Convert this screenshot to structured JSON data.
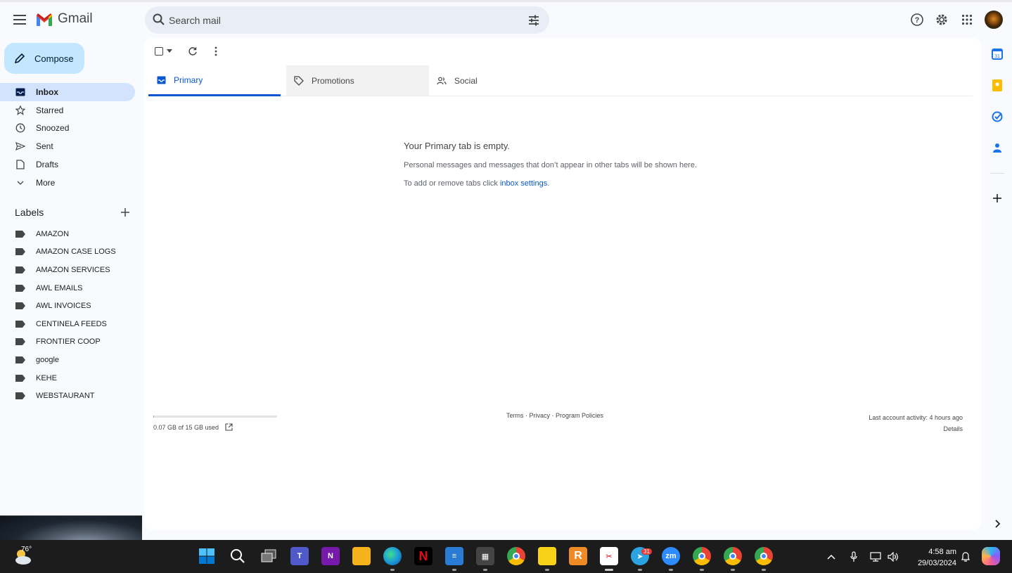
{
  "header": {
    "app_name": "Gmail",
    "search_placeholder": "Search mail"
  },
  "nav": {
    "compose_label": "Compose",
    "items": [
      {
        "label": "Inbox",
        "icon": "inbox-icon",
        "active": true
      },
      {
        "label": "Starred",
        "icon": "star-icon"
      },
      {
        "label": "Snoozed",
        "icon": "clock-icon"
      },
      {
        "label": "Sent",
        "icon": "send-icon"
      },
      {
        "label": "Drafts",
        "icon": "draft-icon"
      },
      {
        "label": "More",
        "icon": "chevron-down-icon"
      }
    ],
    "labels_heading": "Labels",
    "labels": [
      "AMAZON",
      "AMAZON CASE LOGS",
      "AMAZON SERVICES",
      "AWL EMAILS",
      "AWL INVOICES",
      "CENTINELA FEEDS",
      "FRONTIER COOP",
      "google",
      "KEHE",
      "WEBSTAURANT"
    ]
  },
  "tabs": {
    "primary": "Primary",
    "promotions": "Promotions",
    "social": "Social"
  },
  "empty_state": {
    "title": "Your Primary tab is empty.",
    "line1": "Personal messages and messages that don’t appear in other tabs will be shown here.",
    "line2_prefix": "To add or remove tabs click ",
    "line2_link": "inbox settings",
    "line2_suffix": "."
  },
  "footer": {
    "storage_text": "0.07 GB of 15 GB used",
    "storage_fraction": 0.005,
    "links": "Terms · Privacy · Program Policies",
    "activity": "Last account activity: 4 hours ago",
    "details": "Details"
  },
  "taskbar": {
    "temperature": "76°",
    "time": "4:58 am",
    "date": "29/03/2024",
    "telegram_badge": "31"
  },
  "colors": {
    "accent": "#0b57d0",
    "compose_bg": "#c2e7ff",
    "active_nav": "#d3e3fd"
  }
}
